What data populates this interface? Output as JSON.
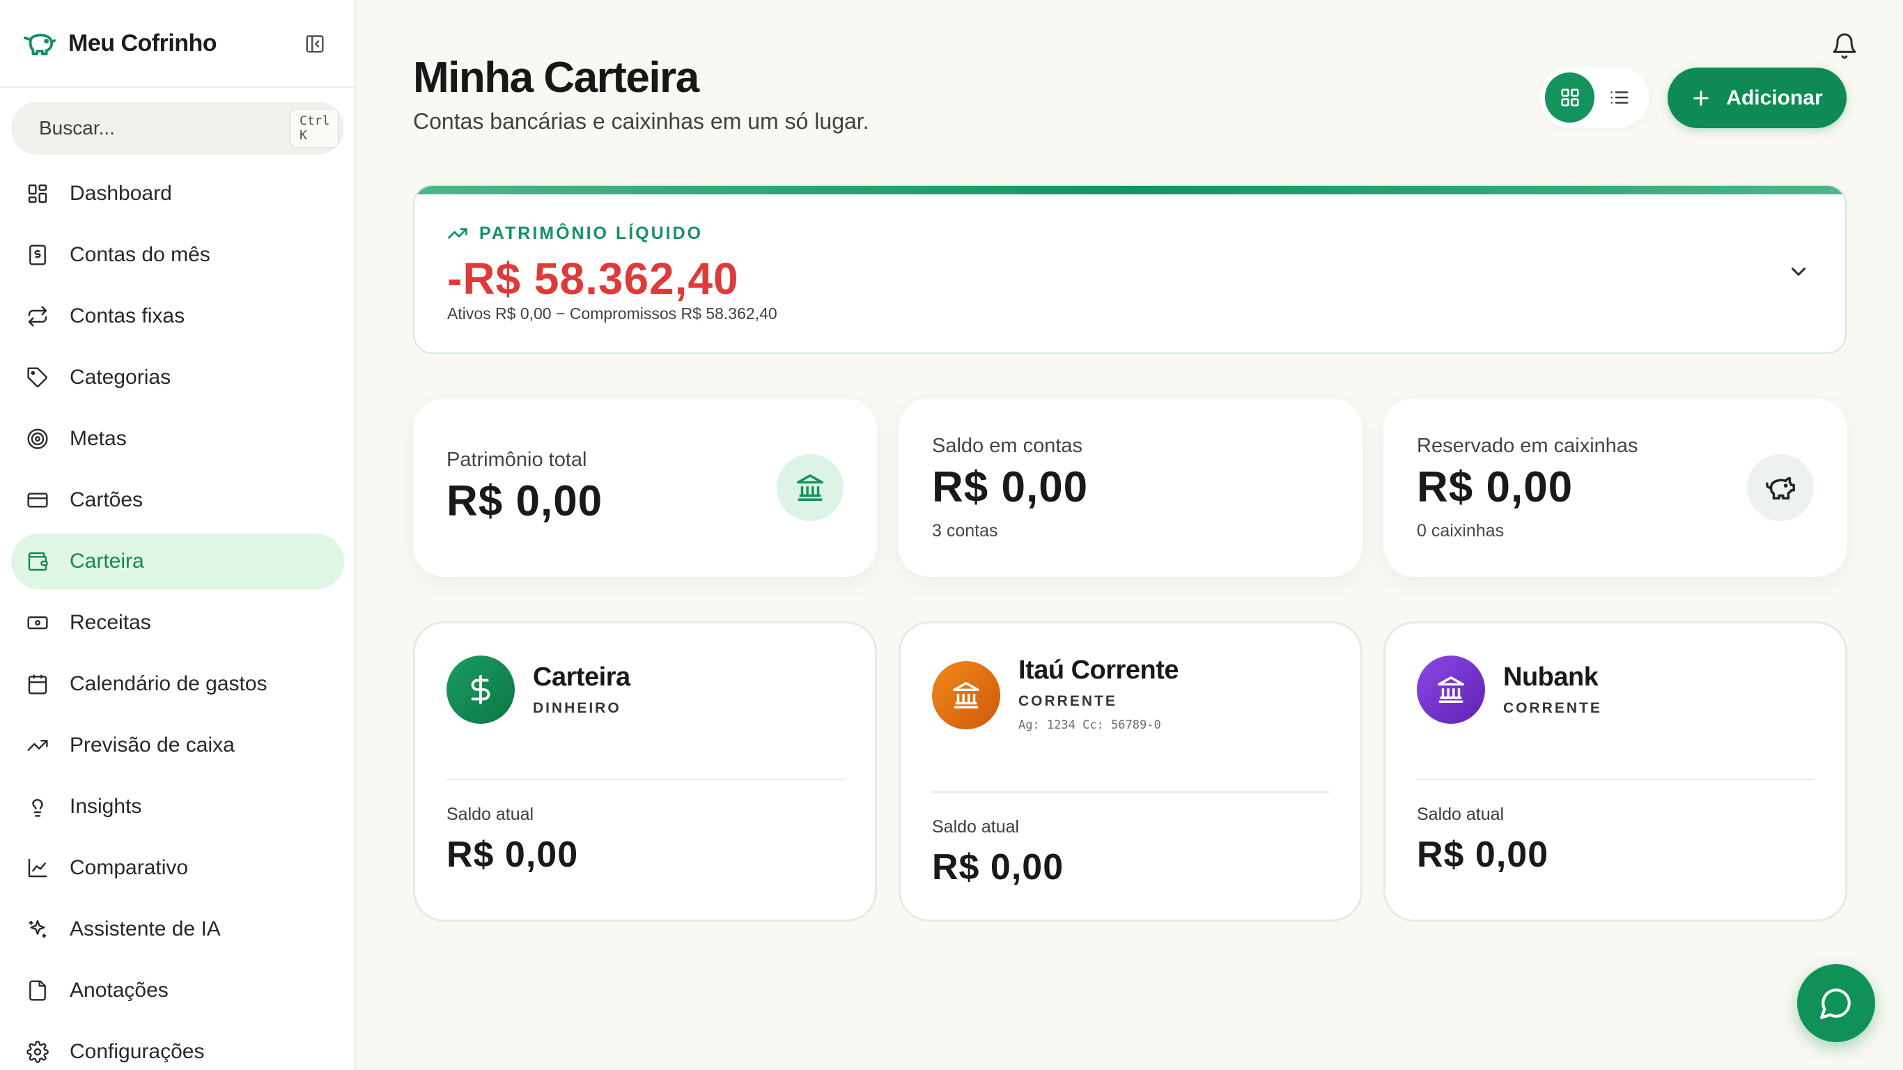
{
  "app": {
    "name": "Meu Cofrinho"
  },
  "search": {
    "placeholder": "Buscar...",
    "shortcut": "Ctrl K"
  },
  "sidebar": {
    "items": [
      {
        "label": "Dashboard",
        "icon": "dashboard-icon"
      },
      {
        "label": "Contas do mês",
        "icon": "receipt-icon"
      },
      {
        "label": "Contas fixas",
        "icon": "repeat-icon"
      },
      {
        "label": "Categorias",
        "icon": "tag-icon"
      },
      {
        "label": "Metas",
        "icon": "target-icon"
      },
      {
        "label": "Cartões",
        "icon": "credit-card-icon"
      },
      {
        "label": "Carteira",
        "icon": "wallet-icon",
        "active": true
      },
      {
        "label": "Receitas",
        "icon": "banknote-icon"
      },
      {
        "label": "Calendário de gastos",
        "icon": "calendar-icon"
      },
      {
        "label": "Previsão de caixa",
        "icon": "trending-up-icon"
      },
      {
        "label": "Insights",
        "icon": "lightbulb-icon"
      },
      {
        "label": "Comparativo",
        "icon": "line-chart-icon"
      },
      {
        "label": "Assistente de IA",
        "icon": "sparkles-icon"
      },
      {
        "label": "Anotações",
        "icon": "note-icon"
      },
      {
        "label": "Configurações",
        "icon": "settings-icon"
      }
    ]
  },
  "header": {
    "title": "Minha Carteira",
    "subtitle": "Contas bancárias e caixinhas em um só lugar.",
    "add_label": "Adicionar",
    "view_mode": "grid"
  },
  "net_worth": {
    "label": "PATRIMÔNIO LÍQUIDO",
    "value": "-R$ 58.362,40",
    "detail": "Ativos R$ 0,00 − Compromissos R$ 58.362,40"
  },
  "summary": [
    {
      "label": "Patrimônio total",
      "value": "R$ 0,00",
      "sub": "",
      "icon": "bank-icon"
    },
    {
      "label": "Saldo em contas",
      "value": "R$ 0,00",
      "sub": "3 contas",
      "icon": ""
    },
    {
      "label": "Reservado em caixinhas",
      "value": "R$ 0,00",
      "sub": "0 caixinhas",
      "icon": "piggy-bank-icon"
    }
  ],
  "accounts": [
    {
      "name": "Carteira",
      "type": "DINHEIRO",
      "extra": "",
      "balance_label": "Saldo atual",
      "balance": "R$ 0,00",
      "icon": "dollar-icon",
      "color": "#138a55"
    },
    {
      "name": "Itaú Corrente",
      "type": "CORRENTE",
      "extra": "Ag: 1234 Cc: 56789-0",
      "balance_label": "Saldo atual",
      "balance": "R$ 0,00",
      "icon": "bank-icon",
      "color": "#e06a0f"
    },
    {
      "name": "Nubank",
      "type": "CORRENTE",
      "extra": "",
      "balance_label": "Saldo atual",
      "balance": "R$ 0,00",
      "icon": "bank-icon",
      "color": "#7c3ad6"
    }
  ],
  "colors": {
    "accent": "#13925d",
    "negative": "#de3a3a",
    "background": "#f9f8f2"
  }
}
